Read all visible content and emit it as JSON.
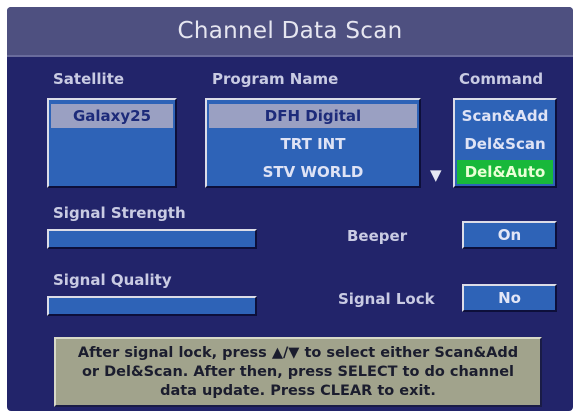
{
  "title": "Channel Data Scan",
  "satellite": {
    "label": "Satellite",
    "items": [
      "Galaxy25"
    ]
  },
  "program": {
    "label": "Program Name",
    "items": [
      "DFH Digital",
      "TRT INT",
      "STV WORLD"
    ],
    "scroll_icon": "down-triangle"
  },
  "command": {
    "label": "Command",
    "items": [
      "Scan&Add",
      "Del&Scan",
      "Del&Auto"
    ]
  },
  "signal_strength": {
    "label": "Signal Strength"
  },
  "signal_quality": {
    "label": "Signal Quality"
  },
  "beeper": {
    "label": "Beeper",
    "value": "On"
  },
  "signal_lock": {
    "label": "Signal Lock",
    "value": "No"
  },
  "help_text": "After signal lock, press ▲/▼ to select either Scan&Add\nor Del&Scan. After then, press SELECT to do channel\ndata update. Press CLEAR to exit.",
  "colors": {
    "background": "#22246a",
    "title_bar": "#4e5080",
    "field": "#2e63b7",
    "selected_row": "#9aa0c2",
    "active_command": "#18b83a",
    "help_box": "#a1a38c"
  }
}
